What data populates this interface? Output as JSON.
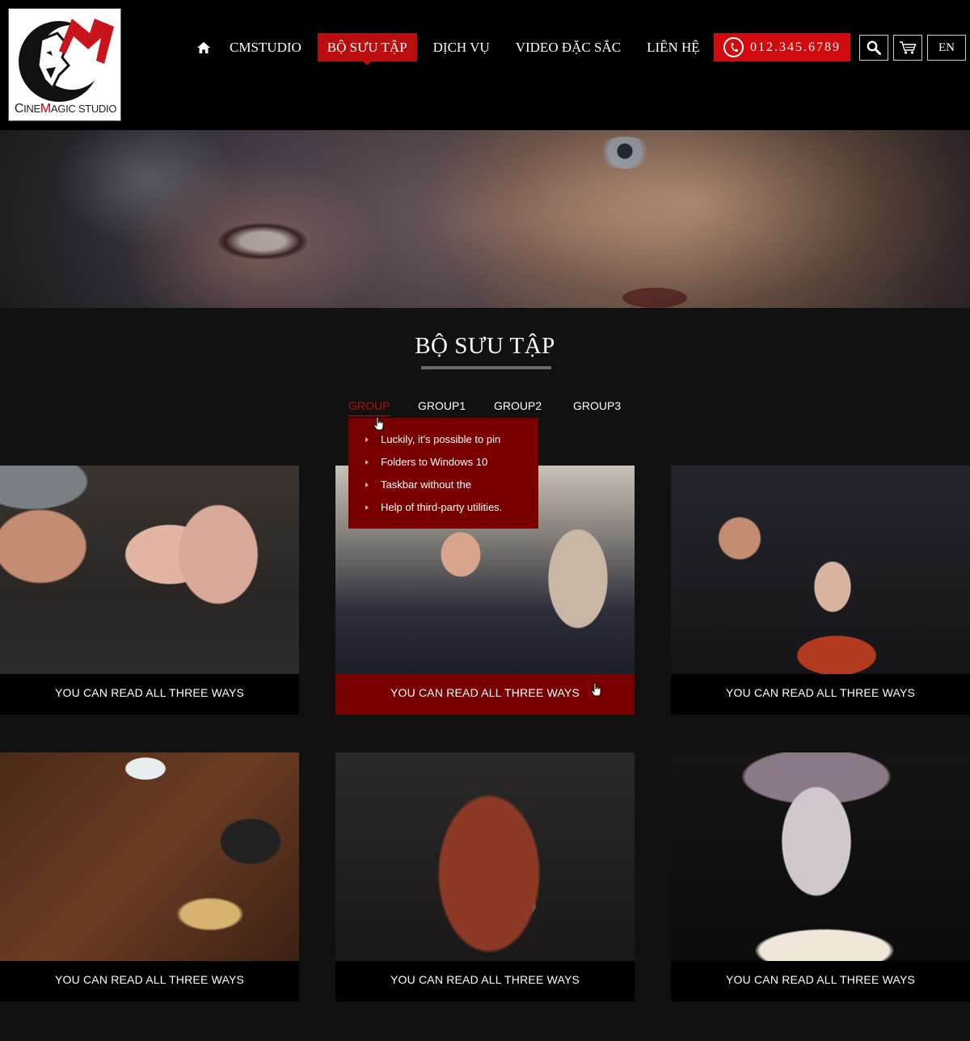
{
  "header": {
    "logo_text": "CINEMAGIC STUDIO",
    "nav": [
      {
        "label": "CMSTUDIO",
        "active": false
      },
      {
        "label": "BỘ SƯU TẬP",
        "active": true
      },
      {
        "label": "DỊCH VỤ",
        "active": false
      },
      {
        "label": "VIDEO ĐẶC SẮC",
        "active": false
      },
      {
        "label": "LIÊN HỆ",
        "active": false
      }
    ],
    "phone": "012.345.6789",
    "language": "EN"
  },
  "section": {
    "title": "BỘ SƯU TẬP"
  },
  "tabs": [
    {
      "label": "GROUP",
      "active": true
    },
    {
      "label": "GROUP1",
      "active": false
    },
    {
      "label": "GROUP2",
      "active": false
    },
    {
      "label": "GROUP3",
      "active": false
    }
  ],
  "dropdown": {
    "items": [
      "Luckily, it's possible to pin",
      "Folders to Windows 10",
      "Taskbar without the",
      "Help of third-party utilities."
    ]
  },
  "gallery": [
    {
      "caption": "YOU CAN READ ALL THREE WAYS"
    },
    {
      "caption": "YOU CAN READ ALL THREE WAYS"
    },
    {
      "caption": "YOU CAN READ ALL THREE WAYS"
    },
    {
      "caption": "YOU CAN READ ALL THREE WAYS"
    },
    {
      "caption": "YOU CAN READ ALL THREE WAYS"
    },
    {
      "caption": "YOU CAN READ ALL THREE WAYS"
    }
  ],
  "colors": {
    "accent_red": "#b90d0f",
    "dropdown_red": "#7a0000",
    "phone_red": "#d10a0d",
    "background": "#111111"
  },
  "icons": [
    "home-icon",
    "phone-icon",
    "search-icon",
    "cart-icon",
    "hand-cursor-icon",
    "bullet-arrow-icon"
  ]
}
